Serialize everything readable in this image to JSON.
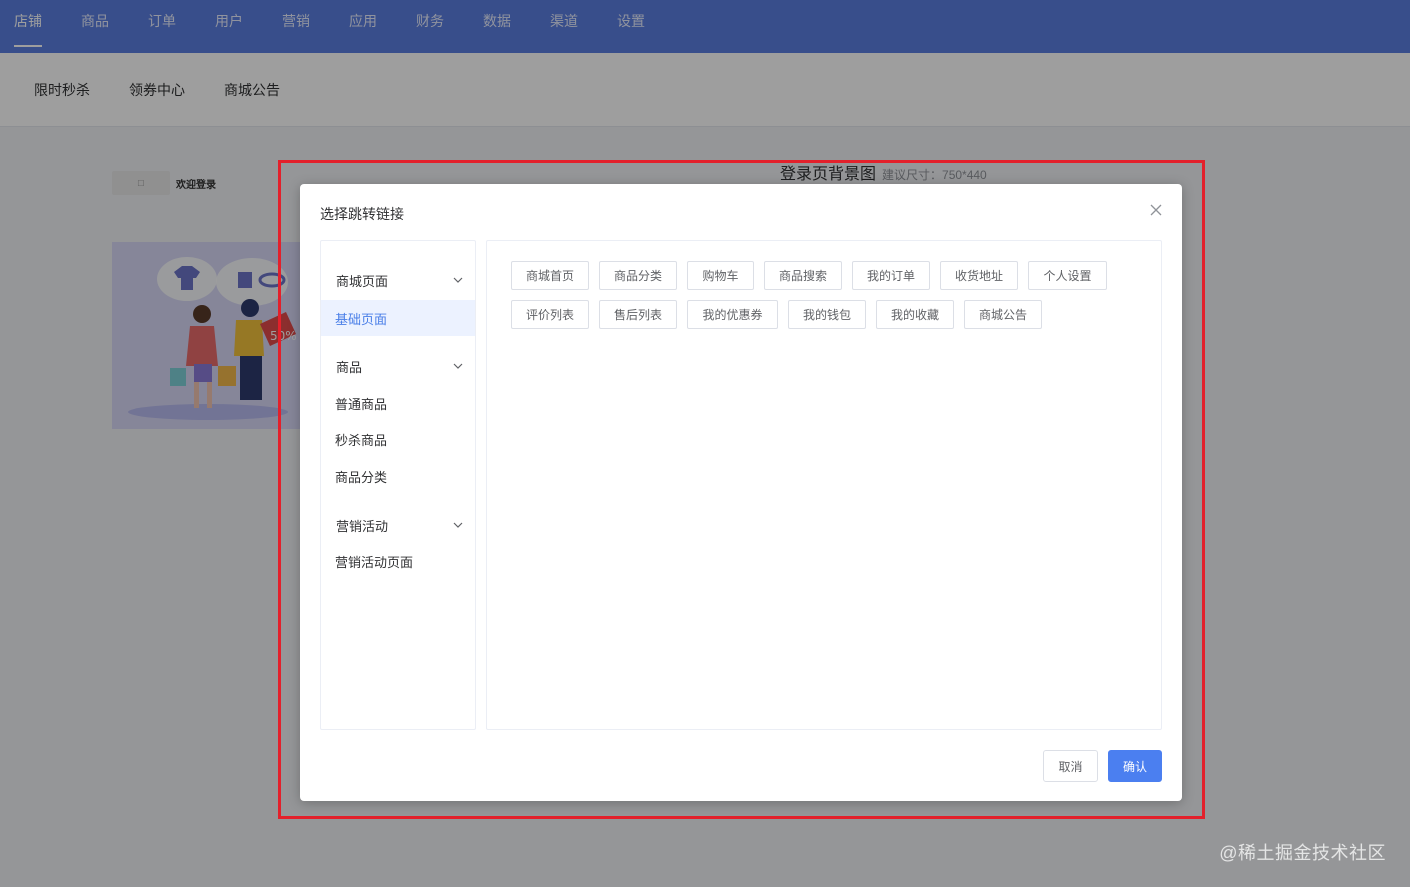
{
  "topnav": {
    "items": [
      "店铺",
      "商品",
      "订单",
      "用户",
      "营销",
      "应用",
      "财务",
      "数据",
      "渠道",
      "设置"
    ],
    "active_index": 0
  },
  "subnav": {
    "items": [
      "限时秒杀",
      "领券中心",
      "商城公告"
    ]
  },
  "background": {
    "login_preview_button": "☐",
    "welcome_text": "欢迎登录",
    "title": "登录页背景图",
    "size_hint": "建议尺寸：750*440"
  },
  "dialog": {
    "title": "选择跳转链接",
    "menu": {
      "groups": [
        {
          "label": "商城页面",
          "items": [
            {
              "label": "基础页面",
              "active": true
            }
          ]
        },
        {
          "label": "商品",
          "items": [
            {
              "label": "普通商品"
            },
            {
              "label": "秒杀商品"
            },
            {
              "label": "商品分类"
            }
          ]
        },
        {
          "label": "营销活动",
          "items": [
            {
              "label": "营销活动页面"
            }
          ]
        }
      ]
    },
    "links": [
      "商城首页",
      "商品分类",
      "购物车",
      "商品搜索",
      "我的订单",
      "收货地址",
      "个人设置",
      "评价列表",
      "售后列表",
      "我的优惠券",
      "我的钱包",
      "我的收藏",
      "商城公告"
    ],
    "cancel_label": "取消",
    "confirm_label": "确认"
  },
  "watermark": "@稀土掘金技术社区",
  "colors": {
    "topnav_bg": "#5b7fe0",
    "primary": "#4b7ff0",
    "highlight_border": "#e3202b"
  }
}
